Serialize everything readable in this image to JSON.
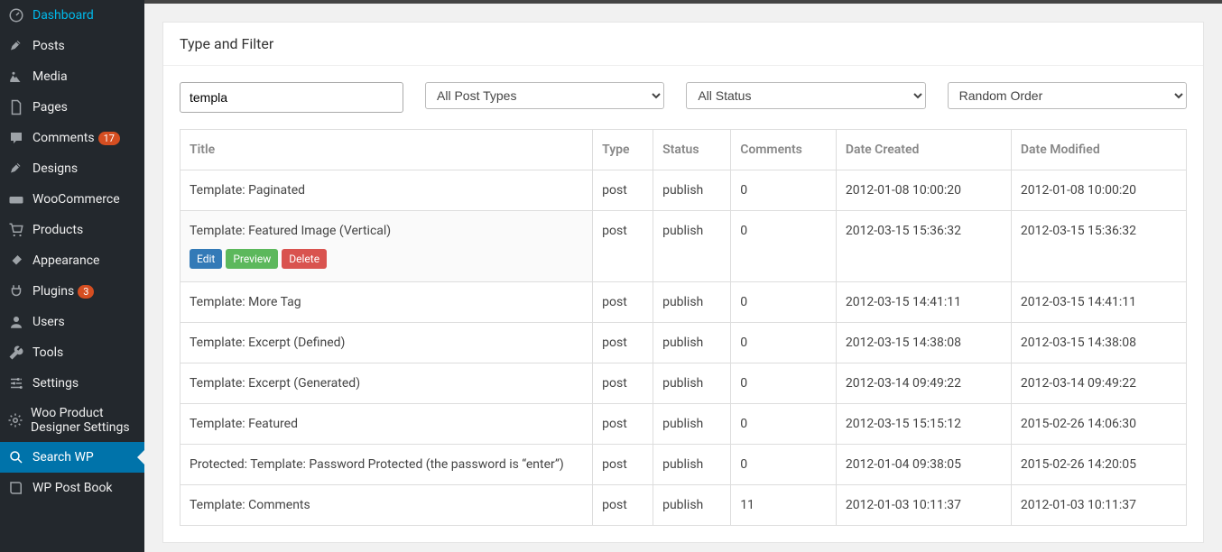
{
  "sidebar": {
    "items": [
      {
        "label": "Dashboard",
        "icon": "dashboard",
        "active": false
      },
      {
        "label": "Posts",
        "icon": "pin",
        "active": false
      },
      {
        "label": "Media",
        "icon": "media",
        "active": false
      },
      {
        "label": "Pages",
        "icon": "pages",
        "active": false
      },
      {
        "label": "Comments",
        "icon": "comment",
        "badge": "17",
        "active": false
      },
      {
        "label": "Designs",
        "icon": "pin",
        "active": false
      },
      {
        "label": "WooCommerce",
        "icon": "woo",
        "active": false
      },
      {
        "label": "Products",
        "icon": "cart",
        "active": false
      },
      {
        "label": "Appearance",
        "icon": "brush",
        "active": false
      },
      {
        "label": "Plugins",
        "icon": "plug",
        "badge": "3",
        "active": false
      },
      {
        "label": "Users",
        "icon": "user",
        "active": false
      },
      {
        "label": "Tools",
        "icon": "wrench",
        "active": false
      },
      {
        "label": "Settings",
        "icon": "sliders",
        "active": false
      },
      {
        "label": "Woo Product Designer Settings",
        "icon": "gear",
        "active": false
      },
      {
        "label": "Search WP",
        "icon": "search",
        "active": true
      },
      {
        "label": "WP Post Book",
        "icon": "book",
        "active": false
      }
    ]
  },
  "panel": {
    "title": "Type and Filter",
    "search_value": "templa",
    "type_label": "All Post Types",
    "status_label": "All Status",
    "order_label": "Random Order"
  },
  "columns": [
    "Title",
    "Type",
    "Status",
    "Comments",
    "Date Created",
    "Date Modified"
  ],
  "actions": {
    "edit": "Edit",
    "preview": "Preview",
    "delete": "Delete"
  },
  "rows": [
    {
      "title": "Template: Paginated",
      "type": "post",
      "status": "publish",
      "comments": "0",
      "created": "2012-01-08 10:00:20",
      "modified": "2012-01-08 10:00:20",
      "hovered": false
    },
    {
      "title": "Template: Featured Image (Vertical)",
      "type": "post",
      "status": "publish",
      "comments": "0",
      "created": "2012-03-15 15:36:32",
      "modified": "2012-03-15 15:36:32",
      "hovered": true
    },
    {
      "title": "Template: More Tag",
      "type": "post",
      "status": "publish",
      "comments": "0",
      "created": "2012-03-15 14:41:11",
      "modified": "2012-03-15 14:41:11",
      "hovered": false
    },
    {
      "title": "Template: Excerpt (Defined)",
      "type": "post",
      "status": "publish",
      "comments": "0",
      "created": "2012-03-15 14:38:08",
      "modified": "2012-03-15 14:38:08",
      "hovered": false
    },
    {
      "title": "Template: Excerpt (Generated)",
      "type": "post",
      "status": "publish",
      "comments": "0",
      "created": "2012-03-14 09:49:22",
      "modified": "2012-03-14 09:49:22",
      "hovered": false
    },
    {
      "title": "Template: Featured",
      "type": "post",
      "status": "publish",
      "comments": "0",
      "created": "2012-03-15 15:15:12",
      "modified": "2015-02-26 14:06:30",
      "hovered": false
    },
    {
      "title": "Protected: Template: Password Protected (the password is “enter”)",
      "type": "post",
      "status": "publish",
      "comments": "0",
      "created": "2012-01-04 09:38:05",
      "modified": "2015-02-26 14:20:05",
      "hovered": false
    },
    {
      "title": "Template: Comments",
      "type": "post",
      "status": "publish",
      "comments": "11",
      "created": "2012-01-03 10:11:37",
      "modified": "2012-01-03 10:11:37",
      "hovered": false
    }
  ]
}
